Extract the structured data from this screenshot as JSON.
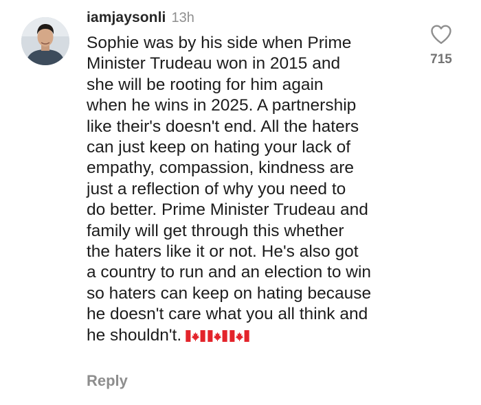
{
  "comment": {
    "username": "iamjaysonli",
    "time": "13h",
    "text_lines": [
      "Sophie was by his side when Prime",
      "Minister Trudeau won in 2015 and",
      "she will be rooting for him again",
      "when he wins in 2025. A partnership",
      "like their's doesn't end. All the haters",
      "can just keep on hating your lack of",
      "empathy, compassion, kindness are",
      "just a reflection of why you need to",
      "do better. Prime Minister Trudeau and",
      "family will get through this whether",
      "the haters like it or not. He's also got",
      "a country to run and an election to win",
      "so haters can keep on hating because",
      "he doesn't care what you all think and",
      "he shouldn't."
    ],
    "emoji": [
      "canada-flag",
      "canada-flag",
      "canada-flag"
    ],
    "like_count": "715",
    "reply_label": "Reply"
  },
  "colors": {
    "username": "#262626",
    "muted": "#8e8e8e",
    "flag_red": "#e3242b"
  }
}
